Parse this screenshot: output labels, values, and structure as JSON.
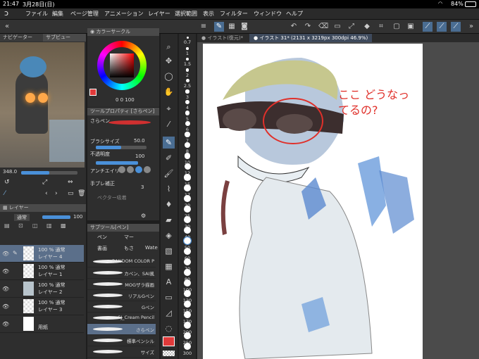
{
  "status": {
    "time": "21:47",
    "date": "3月28日(日)",
    "battery": "84%"
  },
  "menu": [
    "ファイル",
    "編集",
    "ページ管理",
    "アニメーション",
    "レイヤー",
    "選択範囲",
    "表示",
    "フィルター",
    "ウィンドウ",
    "ヘルプ"
  ],
  "navigator": {
    "tab1": "ナビゲーター",
    "tab2": "サブビュー",
    "zoom": "348.0"
  },
  "color": {
    "title": "カラーサークル",
    "values": "0 0 100",
    "main": "#e03a3a"
  },
  "tool_property": {
    "title": "ツールプロパティ [さらペン]",
    "brush_name": "さらペン",
    "brush_size_label": "ブラシサイズ",
    "brush_size": "50.0",
    "opacity_label": "不透明度",
    "opacity": "100",
    "opacity_pct": 1.0,
    "antialias_label": "アンチエイリ",
    "correction_label": "手ブレ補正",
    "correction": "3",
    "vector_label": "ベクター吸着"
  },
  "layers": {
    "title": "レイヤー",
    "blend": "通常",
    "opacity": "100",
    "items": [
      {
        "pct": "100 %  通常",
        "name": "レイヤー 4",
        "sel": true
      },
      {
        "pct": "100 %  通常",
        "name": "レイヤー 1",
        "sel": false
      },
      {
        "pct": "100 %  通常",
        "name": "レイヤー 2",
        "sel": false
      },
      {
        "pct": "100 %  通常",
        "name": "レイヤー 3",
        "sel": false
      },
      {
        "pct": "",
        "name": "用紙",
        "sel": false
      }
    ]
  },
  "subtool": {
    "title": "サブツール[ペン]",
    "tab1": "ペン",
    "tab2": "マー",
    "group1": "書画",
    "group2": "もさ",
    "group3": "Wate",
    "brushes": [
      "RANDOM COLOR PEN",
      "カペン、SAI風",
      "MOGザラ描画",
      "リアルGペン",
      "Gペン",
      "SJ_Cream Pencil",
      "さらペン",
      "標準ペンシル",
      "サイズ"
    ]
  },
  "brush_sizes": [
    "0.7",
    "1",
    "1.5",
    "2",
    "2.5",
    "3",
    "4",
    "5",
    "6",
    "7",
    "8",
    "10",
    "12",
    "15",
    "17",
    "20",
    "25",
    "30",
    "40",
    "50",
    "60",
    "70",
    "80",
    "100",
    "120",
    "150",
    "170",
    "200",
    "250",
    "300"
  ],
  "document": {
    "tab1": "イラスト(復元)*",
    "tab2": "イラスト 31* (2131 x 3219px 300dpi 46.9%)"
  },
  "annotation": "ここ どうなってるの?"
}
